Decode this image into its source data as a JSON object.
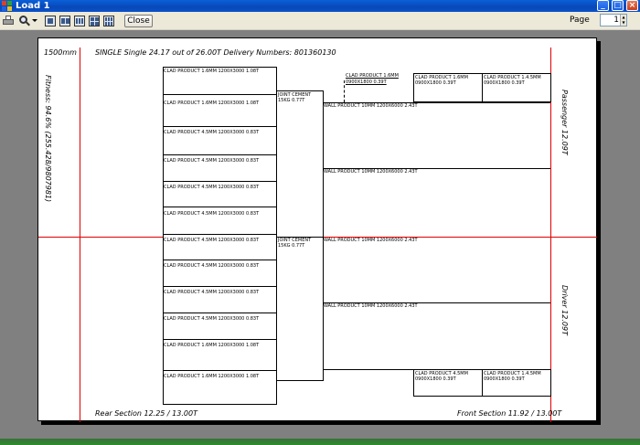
{
  "window": {
    "title": "Load 1",
    "close_glyph": "×",
    "min_glyph": "_",
    "max_glyph": "□"
  },
  "toolbar": {
    "print_icon": "printer-icon",
    "zoom_icon": "magnifier-icon",
    "close_label": "Close",
    "page_label": "Page",
    "page_value": "1"
  },
  "report": {
    "width_label": "1500mm",
    "header": "SINGLE Single 24.17 out of 26.00T  Delivery Numbers: 801360130",
    "fitness": "Fitness: 94.6% (255.428/9807981)",
    "passenger": "Passenger 12.09T",
    "driver": "Driver 12.09T",
    "rear": "Rear Section 12.25 / 13.00T",
    "front": "Front Section 11.92 / 13.00T",
    "clad_cells": [
      "CLAD  PRODUCT  1.6MM  1200X3000  1.08T",
      "CLAD  PRODUCT  1.6MM  1200X3000  1.08T",
      "CLAD  PRODUCT  4.5MM  1200X3000  0.83T",
      "CLAD  PRODUCT  4.5MM  1200X3000  0.83T",
      "CLAD  PRODUCT  4.5MM  1200X3000  0.83T",
      "CLAD  PRODUCT  4.5MM  1200X3000  0.83T",
      "CLAD  PRODUCT  4.5MM  1200X3000  0.83T",
      "CLAD  PRODUCT  4.5MM  1200X3000  0.83T",
      "CLAD  PRODUCT  4.5MM  1200X3000  0.83T",
      "CLAD  PRODUCT  4.5MM  1200X3000  0.83T",
      "CLAD  PRODUCT  1.6MM  1200X3000  1.08T",
      "CLAD  PRODUCT  1.6MM  1200X3000  1.08T"
    ],
    "cement_top": [
      "JOINT CEMENT",
      "15KG 0.77T"
    ],
    "cement_bottom": [
      "JOINT CEMENT",
      "15KG 0.77T"
    ],
    "wall_cells": [
      "WALL  PRODUCT  10MM  1200X6000  2.43T",
      "WALL  PRODUCT  10MM  1200X6000  2.43T",
      "WALL  PRODUCT  10MM  1200X6000  2.43T",
      "WALL  PRODUCT  10MM  1200X6000  2.43T"
    ],
    "small_top": [
      [
        "CLAD PRODUCT 1.6MM",
        "0900X1800  0.39T"
      ],
      [
        "CLAD PRODUCT 1.6MM",
        "0900X1800  0.39T"
      ],
      [
        "CLAD PRODUCT 1.4.5MM",
        "0900X1800  0.39T"
      ]
    ],
    "small_bottom": [
      [
        "CLAD PRODUCT 4.5MM",
        "0900X1800  0.39T"
      ],
      [
        "CLAD PRODUCT 1.4.5MM",
        "0900X1800  0.39T"
      ]
    ]
  }
}
